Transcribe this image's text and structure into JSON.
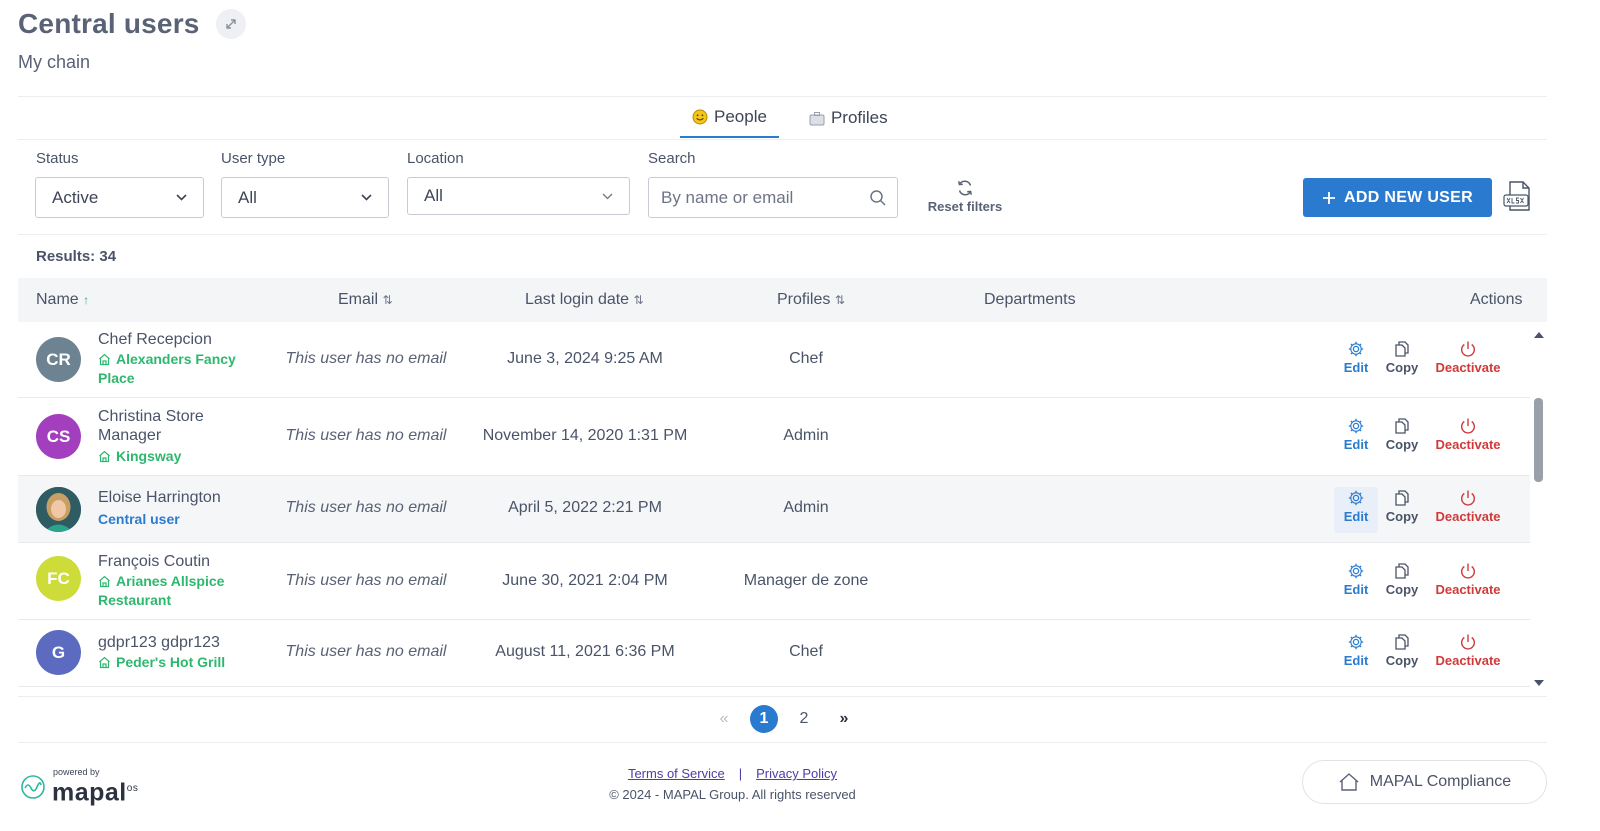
{
  "header": {
    "title": "Central users",
    "subtitle": "My chain"
  },
  "tabs": [
    {
      "label": "People",
      "icon": "smiley-icon",
      "active": true
    },
    {
      "label": "Profiles",
      "icon": "briefcase-icon",
      "active": false
    }
  ],
  "filters": {
    "status": {
      "label": "Status",
      "value": "Active"
    },
    "user_type": {
      "label": "User type",
      "value": "All"
    },
    "location": {
      "label": "Location",
      "value": "All"
    },
    "search": {
      "label": "Search",
      "placeholder": "By name or email"
    },
    "reset_label": "Reset filters"
  },
  "toolbar": {
    "add_user_label": "ADD NEW USER",
    "export_icon": "xlsx-export-icon"
  },
  "results_label": "Results: 34",
  "columns": {
    "name": "Name",
    "email": "Email",
    "last_login": "Last login date",
    "profiles": "Profiles",
    "departments": "Departments",
    "actions": "Actions"
  },
  "actions": {
    "edit": "Edit",
    "copy": "Copy",
    "deactivate": "Deactivate"
  },
  "users": [
    {
      "initials": "CR",
      "name": "Chef Recepcion",
      "location": "Alexanders Fancy Place",
      "email": "This user has no email",
      "last_login": "June 3, 2024 9:25 AM",
      "profile": "Chef",
      "avatar_color": "#6e8391"
    },
    {
      "initials": "CS",
      "name": "Christina Store Manager",
      "location": "Kingsway",
      "email": "This user has no email",
      "last_login": "November 14, 2020 1:31 PM",
      "profile": "Admin",
      "avatar_color": "#a33fbf"
    },
    {
      "initials": "",
      "name": "Eloise Harrington",
      "location": "Central user",
      "email": "This user has no email",
      "last_login": "April 5, 2022 2:21 PM",
      "profile": "Admin",
      "avatar_color": "#2f5b63"
    },
    {
      "initials": "FC",
      "name": "François Coutin",
      "location": "Arianes Allspice Restaurant",
      "email": "This user has no email",
      "last_login": "June 30, 2021 2:04 PM",
      "profile": "Manager de zone",
      "avatar_color": "#cddc39"
    },
    {
      "initials": "G",
      "name": "gdpr123 gdpr123",
      "location": "Peder's Hot Grill",
      "email": "This user has no email",
      "last_login": "August 11, 2021 6:36 PM",
      "profile": "Chef",
      "avatar_color": "#5c6bc0"
    }
  ],
  "pagination": {
    "prev": "«",
    "pages": [
      "1",
      "2"
    ],
    "current": "1",
    "next": "»"
  },
  "footer": {
    "powered_by": "powered by",
    "brand": "mapal",
    "brand_suffix": "os",
    "terms": "Terms of Service",
    "separator": "|",
    "privacy": "Privacy Policy",
    "copyright": "© 2024 - MAPAL Group. All rights reserved",
    "compliance_label": "MAPAL Compliance"
  },
  "colors": {
    "accent": "#2a7bd0",
    "location_green": "#2eb86e",
    "danger": "#d03a3a"
  }
}
